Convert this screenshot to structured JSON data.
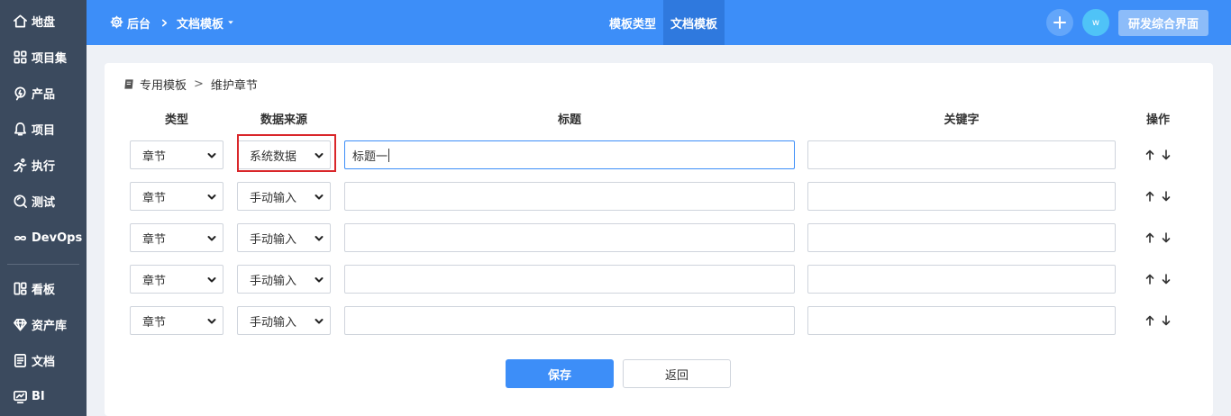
{
  "sidebar": {
    "items": [
      {
        "label": "地盘",
        "icon": "home-icon"
      },
      {
        "label": "项目集",
        "icon": "grid-icon"
      },
      {
        "label": "产品",
        "icon": "bulb-icon"
      },
      {
        "label": "项目",
        "icon": "bell-icon"
      },
      {
        "label": "执行",
        "icon": "run-icon"
      },
      {
        "label": "测试",
        "icon": "search-circle-icon"
      },
      {
        "label": "DevOps",
        "icon": "infinity-icon"
      },
      {
        "label": "看板",
        "icon": "kanban-icon"
      },
      {
        "label": "资产库",
        "icon": "diamond-icon"
      },
      {
        "label": "文档",
        "icon": "document-icon"
      },
      {
        "label": "BI",
        "icon": "monitor-icon"
      }
    ]
  },
  "header": {
    "breadcrumb_root": "后台",
    "breadcrumb_current": "文档模板",
    "tabs": [
      {
        "label": "模板类型",
        "active": false
      },
      {
        "label": "文档模板",
        "active": true
      }
    ],
    "avatar_text": "w",
    "workspace_button": "研发综合界面",
    "accent_color": "#3d8ef8"
  },
  "page": {
    "breadcrumb_parent": "专用模板",
    "breadcrumb_separator": ">",
    "breadcrumb_current": "维护章节"
  },
  "table": {
    "headers": {
      "type": "类型",
      "source": "数据来源",
      "title": "标题",
      "keyword": "关键字",
      "action": "操作"
    },
    "rows": [
      {
        "type": "章节",
        "source": "系统数据",
        "title": "标题一",
        "keyword": ""
      },
      {
        "type": "章节",
        "source": "手动输入",
        "title": "",
        "keyword": ""
      },
      {
        "type": "章节",
        "source": "手动输入",
        "title": "",
        "keyword": ""
      },
      {
        "type": "章节",
        "source": "手动输入",
        "title": "",
        "keyword": ""
      },
      {
        "type": "章节",
        "source": "手动输入",
        "title": "",
        "keyword": ""
      }
    ]
  },
  "actions": {
    "save": "保存",
    "back": "返回"
  }
}
